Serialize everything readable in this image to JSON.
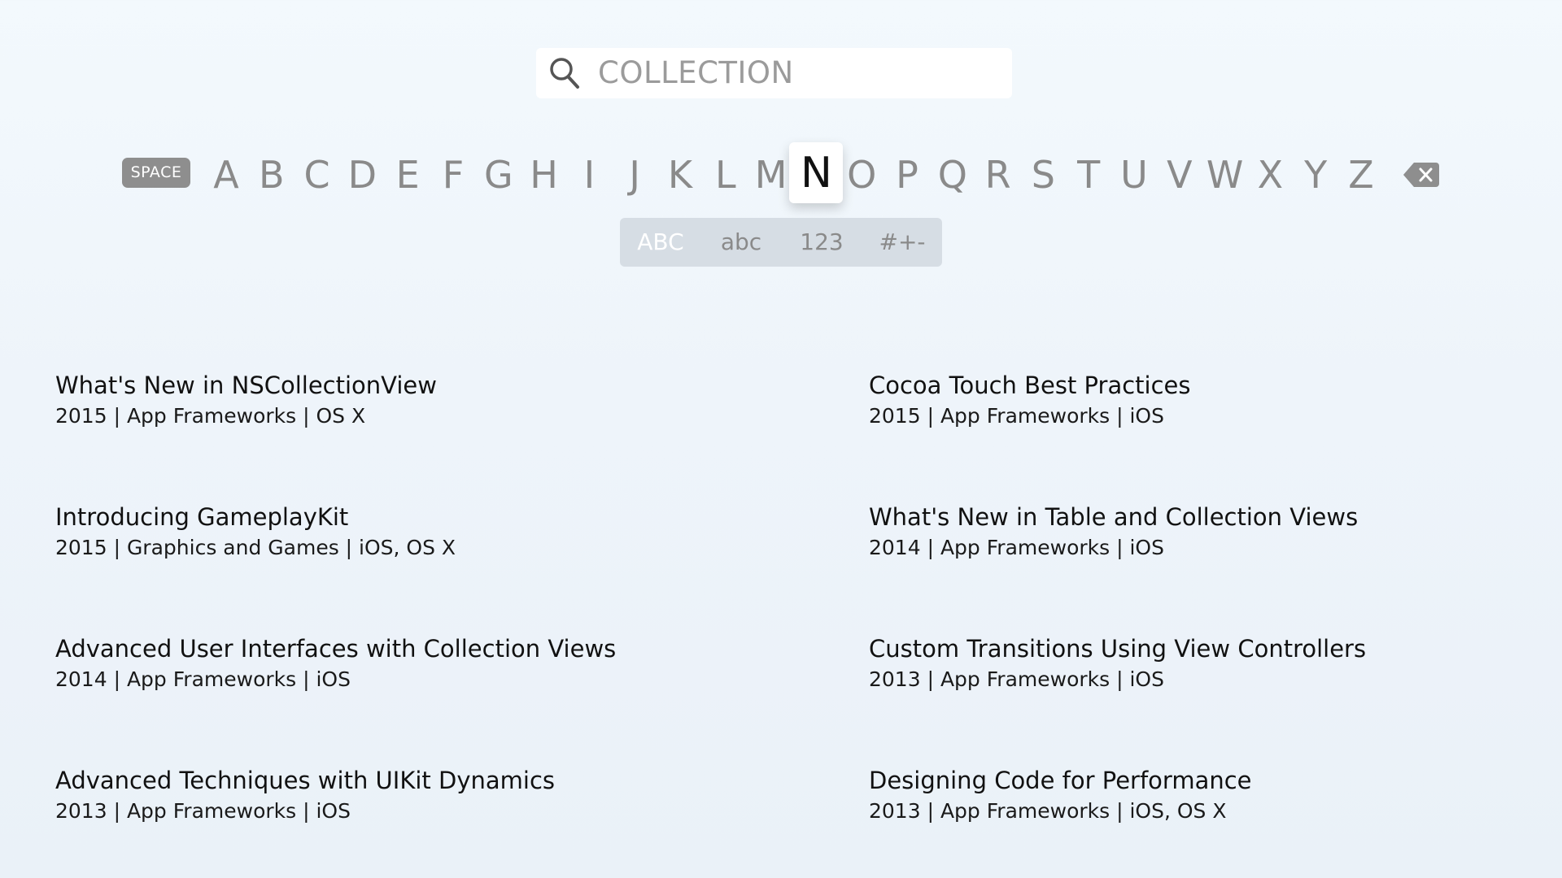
{
  "search": {
    "query": "COLLECTION",
    "icon": "search-icon"
  },
  "keyboard": {
    "space_label": "SPACE",
    "letters": [
      "A",
      "B",
      "C",
      "D",
      "E",
      "F",
      "G",
      "H",
      "I",
      "J",
      "K",
      "L",
      "M",
      "N",
      "O",
      "P",
      "Q",
      "R",
      "S",
      "T",
      "U",
      "V",
      "W",
      "X",
      "Y",
      "Z"
    ],
    "focused_letter": "N",
    "delete_icon": "delete-backward-icon",
    "modes": [
      {
        "label": "ABC",
        "active": true
      },
      {
        "label": "abc",
        "active": false
      },
      {
        "label": "123",
        "active": false
      },
      {
        "label": "#+-",
        "active": false
      }
    ]
  },
  "results": [
    {
      "title": "What's New in NSCollectionView",
      "meta": "2015 | App Frameworks | OS X"
    },
    {
      "title": "Cocoa Touch Best Practices",
      "meta": "2015 | App Frameworks | iOS"
    },
    {
      "title": "Introducing GameplayKit",
      "meta": "2015 | Graphics and Games | iOS, OS X"
    },
    {
      "title": "What's New in Table and Collection Views",
      "meta": "2014 | App Frameworks | iOS"
    },
    {
      "title": "Advanced User Interfaces with Collection Views",
      "meta": "2014 | App Frameworks | iOS"
    },
    {
      "title": "Custom Transitions Using View Controllers",
      "meta": "2013 | App Frameworks | iOS"
    },
    {
      "title": "Advanced Techniques with UIKit Dynamics",
      "meta": "2013 | App Frameworks | iOS"
    },
    {
      "title": "Designing Code for Performance",
      "meta": "2013 | App Frameworks | iOS, OS X"
    }
  ],
  "colors": {
    "focused_key_bg": "#ffffff",
    "key_text": "#8a8a8a",
    "mode_bar_bg": "#d6dde4",
    "space_key_bg": "#8e8e8e"
  }
}
